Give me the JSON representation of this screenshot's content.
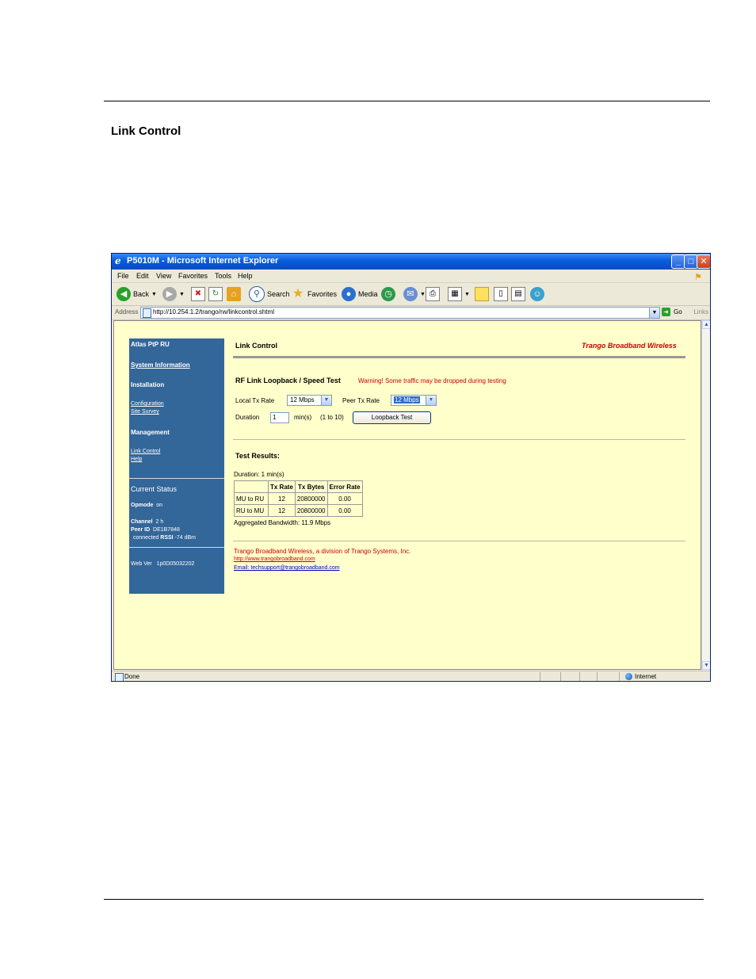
{
  "document": {
    "heading": "Link Control"
  },
  "window": {
    "title": "P5010M - Microsoft Internet Explorer",
    "controls": {
      "minimize": "_",
      "maximize": "□",
      "close": "✕"
    }
  },
  "menu": [
    "File",
    "Edit",
    "View",
    "Favorites",
    "Tools",
    "Help"
  ],
  "toolbar": {
    "back": "Back",
    "search": "Search",
    "favorites": "Favorites",
    "media": "Media"
  },
  "address": {
    "label": "Address",
    "url": "http://10.254.1.2/trango/rw/linkcontrol.shtml",
    "go": "Go",
    "links": "Links"
  },
  "status": {
    "text": "Done",
    "zone": "Internet"
  },
  "sidebar": {
    "product": "Atlas PtP RU",
    "system_information": "System Information",
    "installation": "Installation",
    "configuration": "Configuration",
    "site_survey": "Site Survey",
    "management": "Management",
    "link_control": "Link Control",
    "help": "Help",
    "current_status": "Current Status",
    "opmode_label": "Opmode",
    "opmode_value": "on",
    "channel_label": "Channel",
    "channel_value": "2 h",
    "peer_id_label": "Peer ID",
    "peer_id_value": "DE1B7848",
    "connected_label": "connected",
    "rssi_label": "RSSI",
    "rssi_value": "-74 dBm",
    "web_ver_label": "Web Ver",
    "web_ver_value": "1p0D05032202"
  },
  "main": {
    "title": "Link Control",
    "brand": "Trango Broadband Wireless",
    "section_title": "RF Link Loopback / Speed Test",
    "warning_bold": "Warning!",
    "warning_text": " Some traffic may be dropped during testing",
    "local_tx_label": "Local Tx Rate",
    "local_tx_value": "12 Mbps",
    "peer_tx_label": "Peer Tx Rate",
    "peer_tx_value": "12 Mbps",
    "duration_label": "Duration",
    "duration_value": "1",
    "duration_unit": "min(s)",
    "duration_range": "(1 to 10)",
    "loopback_button": "Loopback Test",
    "results_title": "Test Results:",
    "results_duration": "Duration: 1 min(s)",
    "table": {
      "headers": [
        "",
        "Tx Rate",
        "Tx Bytes",
        "Error Rate"
      ],
      "rows": [
        [
          "MU to RU",
          "12",
          "20800000",
          "0.00"
        ],
        [
          "RU to MU",
          "12",
          "20800000",
          "0.00"
        ]
      ]
    },
    "aggregated": "Aggregated Bandwidth: 11.9 Mbps",
    "footer_company": "Trango Broadband Wireless, a division of Trango Systems, Inc.",
    "footer_web": "http://www.trangobroadband.com",
    "footer_email": "Email: techsupport@trangobroadband.com"
  }
}
